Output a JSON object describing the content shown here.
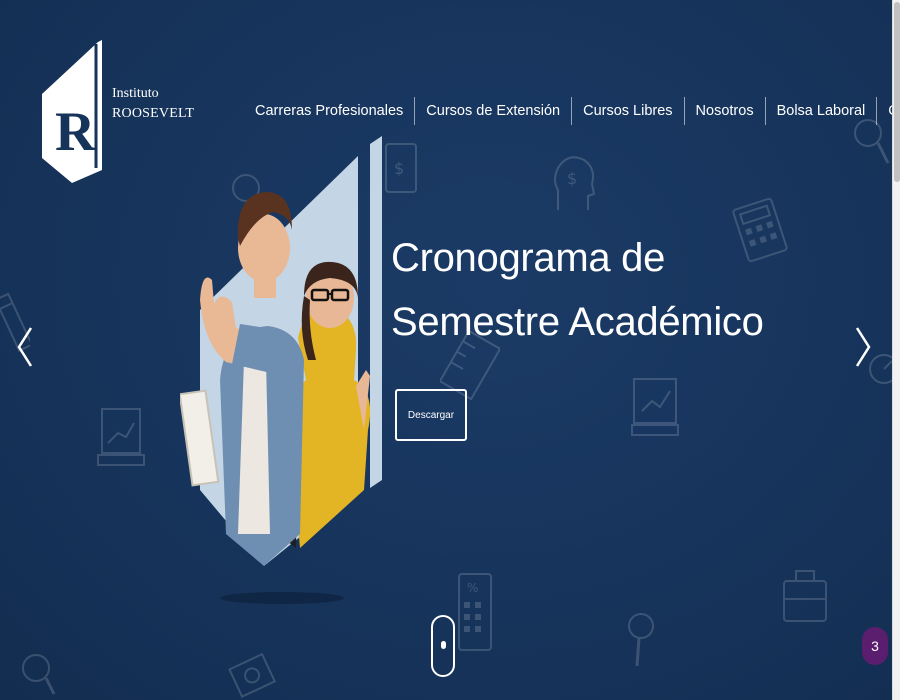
{
  "logo": {
    "letter": "R",
    "line1": "Instituto",
    "line2": "ROOSEVELT"
  },
  "nav": {
    "items": [
      {
        "label": "Carreras Profesionales"
      },
      {
        "label": "Cursos de Extensión"
      },
      {
        "label": "Cursos Libres"
      },
      {
        "label": "Nosotros"
      },
      {
        "label": "Bolsa Laboral"
      },
      {
        "label": "Contacto"
      }
    ]
  },
  "hero": {
    "title_line1": "Cronograma de",
    "title_line2": "Semestre Académico",
    "button_label": "Descargar"
  },
  "chat_badge": {
    "count": "3"
  },
  "icons": [
    "logo-shield-icon",
    "chevron-left-icon",
    "chevron-right-icon",
    "scroll-mouse-icon"
  ],
  "colors": {
    "background": "#16335a",
    "text": "#ffffff",
    "badge": "#5b1d6e"
  }
}
